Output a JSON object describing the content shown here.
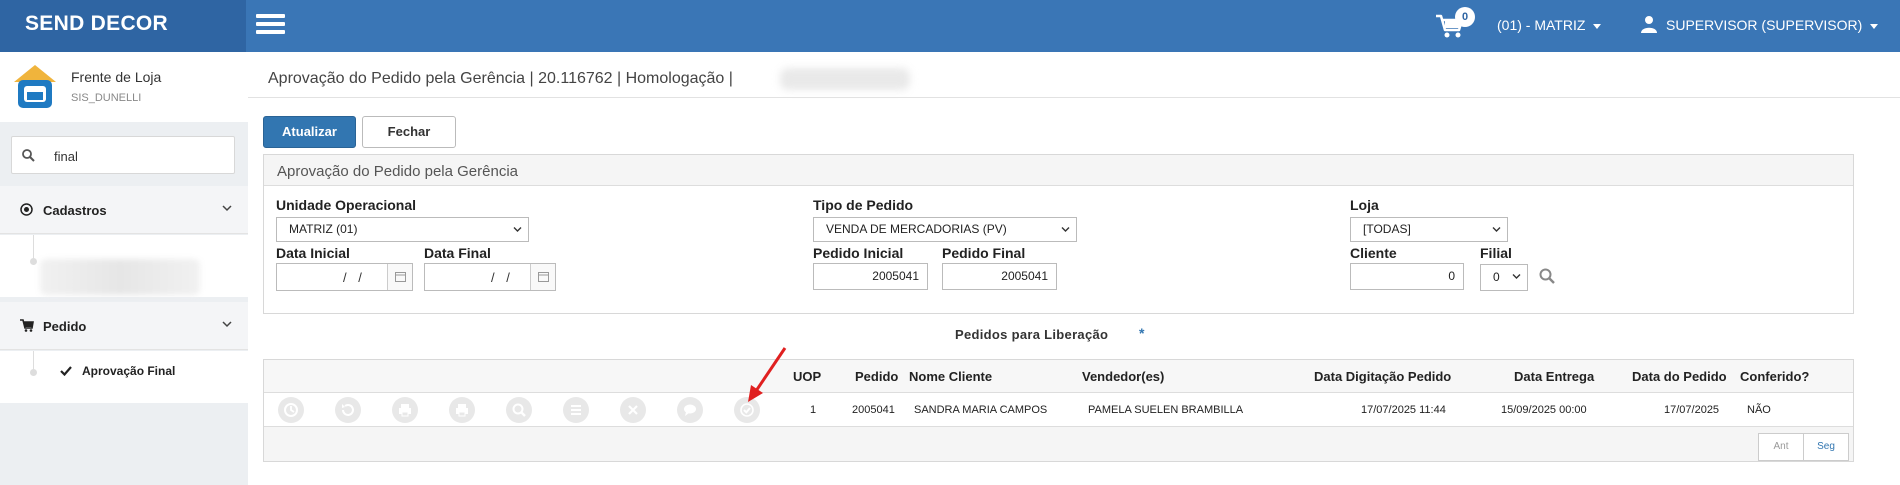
{
  "header": {
    "brand": "SEND DECOR",
    "cart_count": "0",
    "branch": "(01) - MATRIZ",
    "user": "SUPERVISOR (SUPERVISOR)"
  },
  "sidebar": {
    "profile_name": "Frente de Loja",
    "profile_sub": "SIS_DUNELLI",
    "search_value": "final",
    "sections": [
      {
        "label": "Cadastros",
        "icon": "target-icon"
      },
      {
        "label": "Pedido",
        "icon": "cart-icon",
        "items": [
          "Aprovação Final"
        ]
      }
    ]
  },
  "page": {
    "title": "Aprovação do Pedido pela Gerência | 20.116762 | Homologação |"
  },
  "toolbar": {
    "refresh_label": "Atualizar",
    "close_label": "Fechar"
  },
  "filters": {
    "panel_title": "Aprovação do Pedido pela Gerência",
    "unidade_label": "Unidade Operacional",
    "unidade_value": "MATRIZ (01)",
    "tipo_label": "Tipo de Pedido",
    "tipo_value": "VENDA DE MERCADORIAS (PV)",
    "loja_label": "Loja",
    "loja_value": "[TODAS]",
    "data_inicial_label": "Data Inicial",
    "data_inicial_value": "/ /",
    "data_final_label": "Data Final",
    "data_final_value": "/ /",
    "pedido_inicial_label": "Pedido Inicial",
    "pedido_inicial_value": "2005041",
    "pedido_final_label": "Pedido Final",
    "pedido_final_value": "2005041",
    "cliente_label": "Cliente",
    "cliente_value": "0",
    "filial_label": "Filial",
    "filial_value": "0"
  },
  "orders": {
    "section_title": "Pedidos para Liberação",
    "required_mark": "*",
    "columns": [
      "UOP",
      "Pedido",
      "Nome Cliente",
      "Vendedor(es)",
      "Data Digitação Pedido",
      "Data Entrega",
      "Data do Pedido",
      "Conferido?"
    ],
    "rows": [
      {
        "uop": "1",
        "pedido": "2005041",
        "cliente": "SANDRA MARIA CAMPOS",
        "vendedor": "PAMELA SUELEN BRAMBILLA",
        "data_digitacao": "17/07/2025 11:44",
        "data_entrega": "15/09/2025 00:00",
        "data_pedido": "17/07/2025",
        "conferido": "NÃO"
      }
    ],
    "row_actions": [
      "history-icon",
      "undo-icon",
      "print-icon",
      "print-icon",
      "search-icon",
      "list-icon",
      "cancel-icon",
      "comment-icon",
      "approve-icon"
    ],
    "prev_label": "Ant",
    "next_label": "Seg"
  },
  "colors": {
    "topbar": "#3a76b6",
    "brand_bg": "#2f65a3",
    "primary_button": "#3276b1",
    "annotation_arrow": "#e02020"
  }
}
